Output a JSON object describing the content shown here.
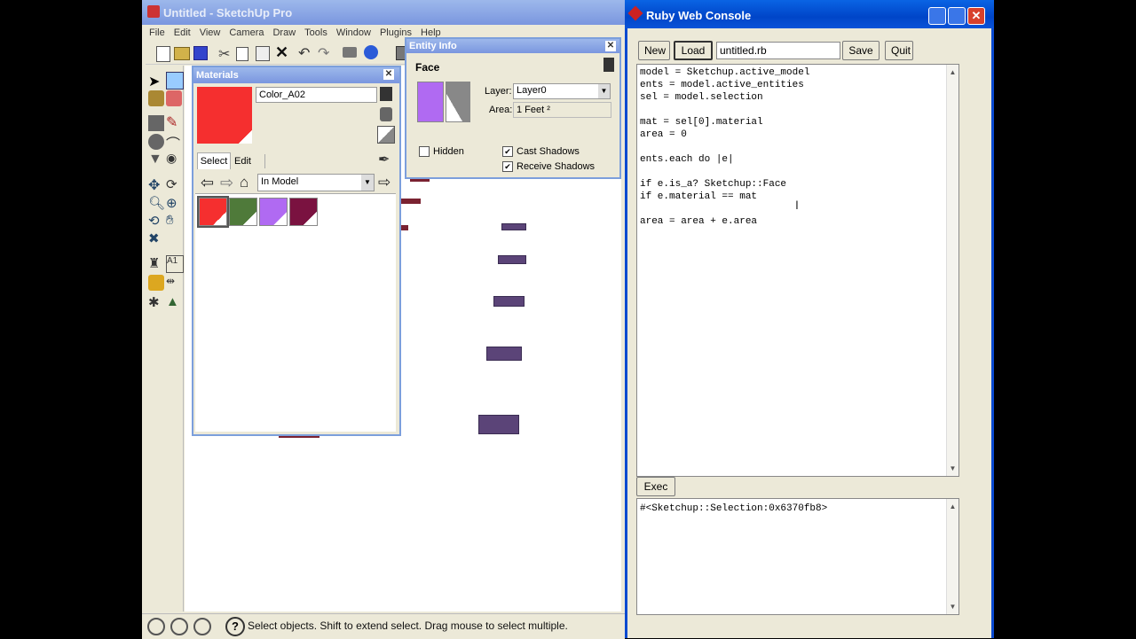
{
  "sketchup": {
    "title": "Untitled - SketchUp Pro",
    "menu": [
      "File",
      "Edit",
      "View",
      "Camera",
      "Draw",
      "Tools",
      "Window",
      "Plugins",
      "Help"
    ],
    "status": "Select objects. Shift to extend select. Drag mouse to select multiple."
  },
  "materials": {
    "title": "Materials",
    "name": "Color_A02",
    "current_color": "#f52f2f",
    "tabs": [
      "Select",
      "Edit"
    ],
    "library": "In Model",
    "swatches": [
      "#f52f2f",
      "#4f7a3a",
      "#b06af2",
      "#7a1240"
    ]
  },
  "entity_info": {
    "title": "Entity Info",
    "type": "Face",
    "layer_label": "Layer:",
    "layer_value": "Layer0",
    "area_label": "Area:",
    "area_value": "1 Feet ²",
    "hidden_label": "Hidden",
    "cast_label": "Cast Shadows",
    "receive_label": "Receive Shadows",
    "front_color": "#b06af2"
  },
  "console": {
    "title": "Ruby Web Console",
    "new_label": "New",
    "load_label": "Load",
    "file_name": "untitled.rb",
    "save_label": "Save",
    "quit_label": "Quit",
    "code": "model = Sketchup.active_model\nents = model.active_entities\nsel = model.selection\n\nmat = sel[0].material\narea = 0\n\nents.each do |e|\n\nif e.is_a? Sketchup::Face\nif e.material == mat\n\narea = area + e.area",
    "exec_label": "Exec",
    "output": "#<Sketchup::Selection:0x6370fb8>"
  }
}
